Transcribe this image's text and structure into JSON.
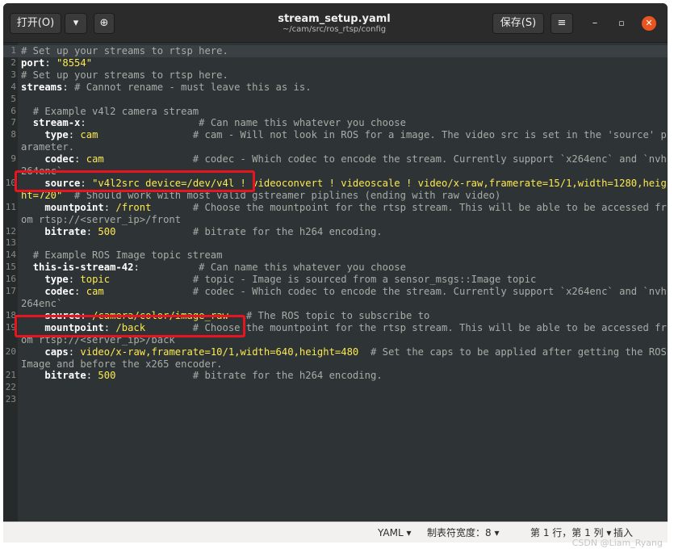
{
  "window": {
    "title": "stream_setup.yaml",
    "subtitle": "~/cam/src/ros_rtsp/config",
    "open_label": "打开(O)",
    "open_menu_icon": "▾",
    "new_doc_icon": "⊕",
    "save_label": "保存(S)",
    "menu_icon": "≡",
    "minimize_icon": "–",
    "maximize_icon": "▫",
    "close_icon": "✕"
  },
  "editor": {
    "lines": [
      {
        "n": "1",
        "parts": [
          {
            "t": "# Set up your streams to rtsp here.",
            "c": "c"
          }
        ],
        "current": true
      },
      {
        "n": "2",
        "parts": [
          {
            "t": "port",
            "c": "k"
          },
          {
            "t": ": ",
            "c": "p"
          },
          {
            "t": "\"8554\"",
            "c": "s"
          }
        ]
      },
      {
        "n": "3",
        "parts": [
          {
            "t": "# Set up your streams to rtsp here.",
            "c": "c"
          }
        ]
      },
      {
        "n": "4",
        "parts": [
          {
            "t": "streams",
            "c": "k"
          },
          {
            "t": ": ",
            "c": "p"
          },
          {
            "t": "# Cannot rename - must leave this as is.",
            "c": "c"
          }
        ]
      },
      {
        "n": "5",
        "parts": []
      },
      {
        "n": "6",
        "parts": [
          {
            "t": "  # Example v4l2 camera stream",
            "c": "c"
          }
        ]
      },
      {
        "n": "7",
        "parts": [
          {
            "t": "  stream-x",
            "c": "k"
          },
          {
            "t": ":                   ",
            "c": "p"
          },
          {
            "t": "# Can name this whatever you choose",
            "c": "c"
          }
        ]
      },
      {
        "n": "8",
        "parts": [
          {
            "t": "    type",
            "c": "k"
          },
          {
            "t": ": ",
            "c": "p"
          },
          {
            "t": "cam",
            "c": "s"
          },
          {
            "t": "                # cam - Will not look in ROS for a image. The video src is set in the 'source' parameter.",
            "c": "c"
          }
        ]
      },
      {
        "n": "9",
        "parts": [
          {
            "t": "    codec",
            "c": "k"
          },
          {
            "t": ": ",
            "c": "p"
          },
          {
            "t": "cam",
            "c": "s"
          },
          {
            "t": "               # codec - Which codec to encode the stream. Currently support `x264enc` and `nvh264enc`",
            "c": "c"
          }
        ]
      },
      {
        "n": "10",
        "parts": [
          {
            "t": "    source",
            "c": "k"
          },
          {
            "t": ": ",
            "c": "p"
          },
          {
            "t": "\"v4l2src device=/dev/v4l ! videoconvert ! videoscale ! video/x-raw,framerate=15/1,width=1280,height=720\"",
            "c": "s"
          },
          {
            "t": "  # Should work with most valid gstreamer piplines (ending with raw video)",
            "c": "c"
          }
        ]
      },
      {
        "n": "11",
        "parts": [
          {
            "t": "    mountpoint",
            "c": "k"
          },
          {
            "t": ": ",
            "c": "p"
          },
          {
            "t": "/front",
            "c": "s"
          },
          {
            "t": "       # Choose the mountpoint for the rtsp stream. This will be able to be accessed from rtsp://<server_ip>/front",
            "c": "c"
          }
        ]
      },
      {
        "n": "12",
        "parts": [
          {
            "t": "    bitrate",
            "c": "k"
          },
          {
            "t": ": ",
            "c": "p"
          },
          {
            "t": "500",
            "c": "s"
          },
          {
            "t": "             # bitrate for the h264 encoding.",
            "c": "c"
          }
        ]
      },
      {
        "n": "13",
        "parts": []
      },
      {
        "n": "14",
        "parts": [
          {
            "t": "  # Example ROS Image topic stream",
            "c": "c"
          }
        ]
      },
      {
        "n": "15",
        "parts": [
          {
            "t": "  this-is-stream-42",
            "c": "k"
          },
          {
            "t": ":          ",
            "c": "p"
          },
          {
            "t": "# Can name this whatever you choose",
            "c": "c"
          }
        ]
      },
      {
        "n": "16",
        "parts": [
          {
            "t": "    type",
            "c": "k"
          },
          {
            "t": ": ",
            "c": "p"
          },
          {
            "t": "topic",
            "c": "s"
          },
          {
            "t": "              # topic - Image is sourced from a sensor_msgs::Image topic",
            "c": "c"
          }
        ]
      },
      {
        "n": "17",
        "parts": [
          {
            "t": "    codec",
            "c": "k"
          },
          {
            "t": ": ",
            "c": "p"
          },
          {
            "t": "cam",
            "c": "s"
          },
          {
            "t": "               # codec - Which codec to encode the stream. Currently support `x264enc` and `nvh264enc`",
            "c": "c"
          }
        ]
      },
      {
        "n": "18",
        "parts": [
          {
            "t": "    source",
            "c": "k"
          },
          {
            "t": ": ",
            "c": "p"
          },
          {
            "t": "/camera/color/image_raw",
            "c": "s"
          },
          {
            "t": "   # The ROS topic to subscribe to",
            "c": "c"
          }
        ]
      },
      {
        "n": "19",
        "parts": [
          {
            "t": "    mountpoint",
            "c": "k"
          },
          {
            "t": ": ",
            "c": "p"
          },
          {
            "t": "/back",
            "c": "s"
          },
          {
            "t": "        # Choose the mountpoint for the rtsp stream. This will be able to be accessed from rtsp://<server_ip>/back",
            "c": "c"
          }
        ]
      },
      {
        "n": "20",
        "parts": [
          {
            "t": "    caps",
            "c": "k"
          },
          {
            "t": ": ",
            "c": "p"
          },
          {
            "t": "video/x-raw,framerate=10/1,width=640,height=480",
            "c": "s"
          },
          {
            "t": "  # Set the caps to be applied after getting the ROS Image and before the x265 encoder.",
            "c": "c"
          }
        ]
      },
      {
        "n": "21",
        "parts": [
          {
            "t": "    bitrate",
            "c": "k"
          },
          {
            "t": ": ",
            "c": "p"
          },
          {
            "t": "500",
            "c": "s"
          },
          {
            "t": "             # bitrate for the h264 encoding.",
            "c": "c"
          }
        ]
      },
      {
        "n": "22",
        "parts": []
      },
      {
        "n": "23",
        "parts": []
      }
    ]
  },
  "statusbar": {
    "language": "YAML ▾",
    "tab_width": "制表符宽度：8 ▾",
    "position": "第 1 行，第 1 列  ▾",
    "insert_mode": "插入"
  },
  "watermark": "CSDN @Liam_Ryang",
  "colors": {
    "editor_bg": "#2e3436",
    "keyword": "#ffffff",
    "string": "#fce94f",
    "comment": "#a8aca6",
    "highlight_box": "#e8141f",
    "close_button": "#e95420"
  }
}
